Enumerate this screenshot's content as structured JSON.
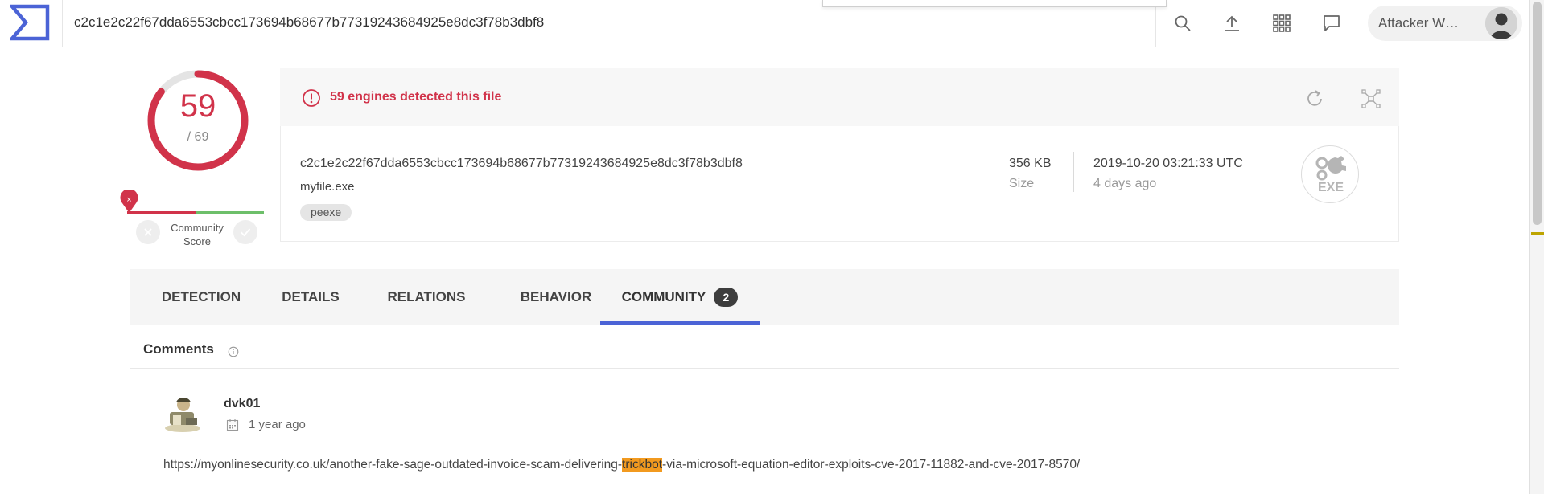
{
  "header": {
    "search_value": "c2c1e2c22f67dda6553cbcc173694b68677b77319243684925e8dc3f78b3dbf8",
    "icons": [
      "search-icon",
      "upload-icon",
      "apps-grid-icon",
      "chat-icon"
    ],
    "user_name": "Attacker W…"
  },
  "score": {
    "detections": "59",
    "total": "/ 69",
    "detection_fraction": 0.855,
    "community_label_line1": "Community",
    "community_label_line2": "Score"
  },
  "detection": {
    "alert_text": "59 engines detected this file",
    "file_hash": "c2c1e2c22f67dda6553cbcc173694b68677b77319243684925e8dc3f78b3dbf8",
    "file_name": "myfile.exe",
    "tag": "peexe",
    "size_value": "356 KB",
    "size_label": "Size",
    "date_value": "2019-10-20 03:21:33 UTC",
    "date_ago": "4 days ago",
    "file_type": "EXE"
  },
  "tabs": [
    {
      "label": "DETECTION"
    },
    {
      "label": "DETAILS"
    },
    {
      "label": "RELATIONS"
    },
    {
      "label": "BEHAVIOR"
    },
    {
      "label": "COMMUNITY",
      "count": "2",
      "active": true
    }
  ],
  "comments": {
    "title": "Comments",
    "items": [
      {
        "user": "dvk01",
        "time": "1 year ago",
        "text_before": "https://myonlinesecurity.co.uk/another-fake-sage-outdated-invoice-scam-delivering-",
        "text_highlight": "trickbot",
        "text_after": "-via-microsoft-equation-editor-exploits-cve-2017-11882-and-cve-2017-8570/"
      }
    ]
  },
  "colors": {
    "accent": "#4b63d6",
    "malicious": "#d1334a",
    "harmless": "#6dbf6a",
    "highlight": "#f29a1f"
  }
}
